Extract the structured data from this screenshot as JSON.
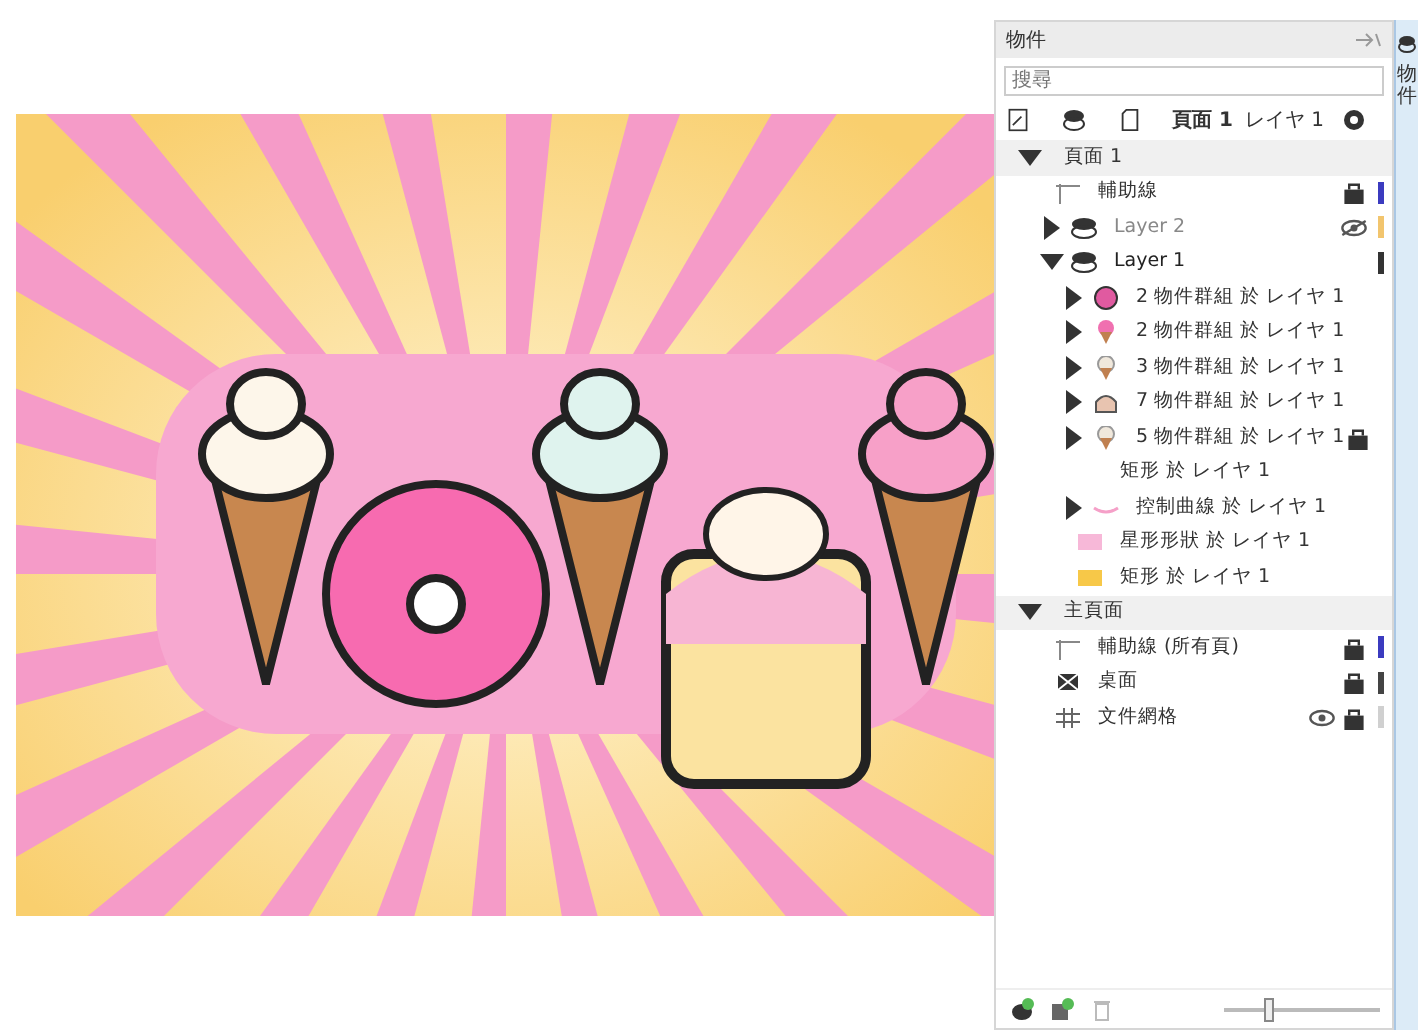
{
  "panel": {
    "title": "物件",
    "search": {
      "placeholder": "搜尋"
    },
    "toolbar": {
      "page": "頁面 1",
      "layer": "レイヤ 1"
    },
    "pages": [
      {
        "name": "頁面 1",
        "expanded": true,
        "children": [
          {
            "kind": "guides",
            "name": "輔助線",
            "locked": true,
            "color": "#3b3bbf"
          },
          {
            "kind": "layer",
            "name": "Layer 2",
            "expanded": false,
            "visible": false,
            "color": "#f2c56e"
          },
          {
            "kind": "layer",
            "name": "Layer 1",
            "expanded": true,
            "color": "#333333",
            "children": [
              {
                "kind": "donut",
                "name": "2 物件群組 於 レイヤ 1",
                "expanded": false
              },
              {
                "kind": "cone-pink",
                "name": "2 物件群組 於 レイヤ 1",
                "expanded": false
              },
              {
                "kind": "cone",
                "name": "3 物件群組 於 レイヤ 1",
                "expanded": false
              },
              {
                "kind": "cake",
                "name": "7 物件群組 於 レイヤ 1",
                "expanded": false
              },
              {
                "kind": "cone",
                "name": "5 物件群組 於 レイヤ 1",
                "expanded": false,
                "locked": true
              },
              {
                "kind": "none",
                "name": "矩形 於 レイヤ 1"
              },
              {
                "kind": "curve",
                "name": "控制曲線 於 レイヤ 1",
                "expanded": false
              },
              {
                "kind": "rect-pink",
                "name": "星形形狀 於 レイヤ 1"
              },
              {
                "kind": "rect-yellow",
                "name": "矩形 於 レイヤ 1"
              }
            ]
          }
        ]
      },
      {
        "name": "主頁面",
        "expanded": true,
        "children": [
          {
            "kind": "guides",
            "name": "輔助線 (所有頁)",
            "locked": true,
            "color": "#3b3bbf"
          },
          {
            "kind": "desktop",
            "name": "桌面",
            "locked": true,
            "color": "#444444"
          },
          {
            "kind": "grid",
            "name": "文件網格",
            "visible": true,
            "locked": true,
            "color": "#d0d0d0"
          }
        ]
      }
    ],
    "zoom_slider": {
      "level": 0.3
    }
  },
  "side_tab": {
    "label": "物件"
  }
}
